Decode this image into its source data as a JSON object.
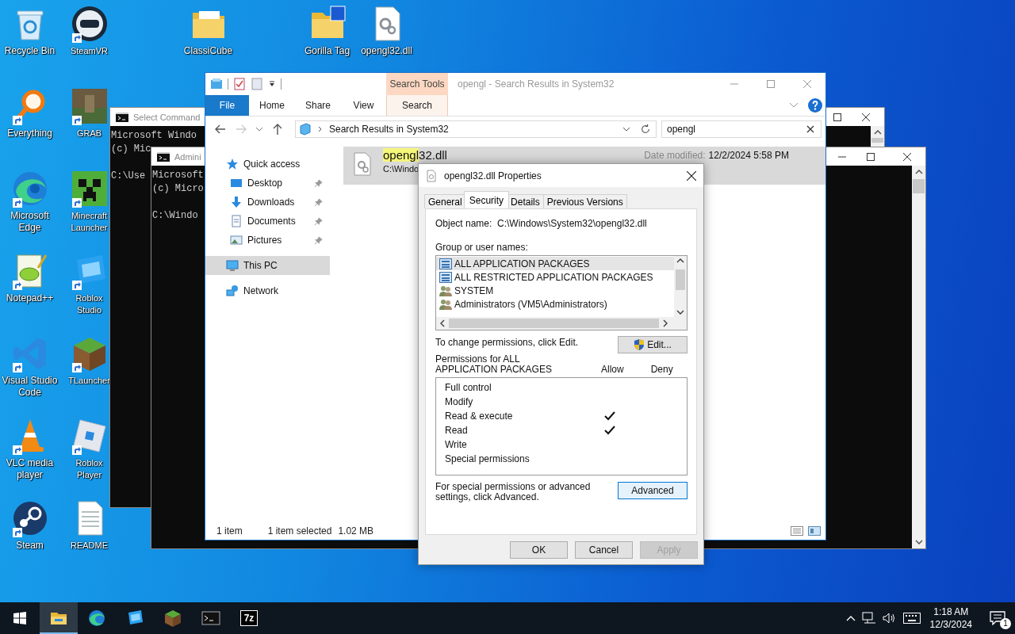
{
  "desktop": {
    "icons": [
      {
        "label": "Recycle Bin",
        "kind": "recycle",
        "shortcut": false
      },
      {
        "label": "Everything",
        "kind": "everything",
        "shortcut": true
      },
      {
        "label": "Microsoft Edge",
        "kind": "edge",
        "shortcut": true
      },
      {
        "label": "Notepad++",
        "kind": "notepad",
        "shortcut": true
      },
      {
        "label": "Visual Studio Code",
        "kind": "vscode",
        "shortcut": true
      },
      {
        "label": "VLC media player",
        "kind": "vlc",
        "shortcut": true
      },
      {
        "label": "Steam",
        "kind": "steam",
        "shortcut": true
      },
      {
        "label": "SteamVR",
        "kind": "vr",
        "shortcut": true
      },
      {
        "label": "GRAB",
        "kind": "photo",
        "shortcut": true
      },
      {
        "label": "Minecraft Launcher",
        "kind": "creeper",
        "shortcut": true
      },
      {
        "label": "Roblox Studio",
        "kind": "studio",
        "shortcut": true
      },
      {
        "label": "TLauncher",
        "kind": "grass",
        "shortcut": true
      },
      {
        "label": "Roblox Player",
        "kind": "roblox",
        "shortcut": true
      },
      {
        "label": "README",
        "kind": "text",
        "shortcut": false
      },
      {
        "label": "ClassiCube",
        "kind": "folder",
        "shortcut": false
      },
      {
        "label": "Gorilla Tag",
        "kind": "zipfolder",
        "shortcut": false
      },
      {
        "label": "opengl32.dll",
        "kind": "dll",
        "shortcut": false
      }
    ]
  },
  "console_windows": [
    {
      "title": "Select Command",
      "header": [
        "Microsoft Windo",
        "(c) Mic"
      ],
      "prompt": "C:\\Use"
    },
    {
      "title": "Admini",
      "header": [
        "Microsoft",
        "(c) Micro"
      ],
      "prompt": "C:\\Windo"
    }
  ],
  "explorer": {
    "title": "opengl - Search Results in System32",
    "context_group": "Search Tools",
    "ribbon_tabs": [
      {
        "label": "File",
        "kind": "file",
        "selected": false
      },
      {
        "label": "Home",
        "kind": "tab",
        "selected": false
      },
      {
        "label": "Share",
        "kind": "tab",
        "selected": false
      },
      {
        "label": "View",
        "kind": "tab",
        "selected": false
      },
      {
        "label": "Search",
        "kind": "context",
        "selected": true
      }
    ],
    "address": "Search Results in System32",
    "search": {
      "value": "opengl"
    },
    "nav": [
      {
        "label": "Quick access",
        "kind": "star",
        "selected": false,
        "children": [
          {
            "label": "Desktop",
            "kind": "desktop",
            "pinned": true,
            "selected": false
          },
          {
            "label": "Downloads",
            "kind": "downloads",
            "pinned": true,
            "selected": false
          },
          {
            "label": "Documents",
            "kind": "documents",
            "pinned": true,
            "selected": false
          },
          {
            "label": "Pictures",
            "kind": "pictures",
            "pinned": true,
            "selected": false
          }
        ]
      },
      {
        "label": "This PC",
        "kind": "pc",
        "selected": true
      },
      {
        "label": "Network",
        "kind": "network",
        "selected": false
      }
    ],
    "results": [
      {
        "match": "opengl",
        "rest": "32.dll",
        "location": "C:\\Windo",
        "date_label": "Date modified:",
        "date": "12/2/2024 5:58 PM",
        "selected": true
      }
    ],
    "status": {
      "count": "1 item",
      "selection": "1 item selected",
      "size": "1.02 MB"
    }
  },
  "properties_dialog": {
    "title": "opengl32.dll Properties",
    "tabs": [
      {
        "label": "General",
        "selected": false
      },
      {
        "label": "Security",
        "selected": true
      },
      {
        "label": "Details",
        "selected": false
      },
      {
        "label": "Previous Versions",
        "selected": false
      }
    ],
    "object_name_label": "Object name:",
    "object_name": "C:\\Windows\\System32\\opengl32.dll",
    "groups_label": "Group or user names:",
    "groups": [
      {
        "name": "ALL APPLICATION PACKAGES",
        "kind": "package",
        "selected": true
      },
      {
        "name": "ALL RESTRICTED APPLICATION PACKAGES",
        "kind": "package",
        "selected": false
      },
      {
        "name": "SYSTEM",
        "kind": "users",
        "selected": false
      },
      {
        "name": "Administrators (VM5\\Administrators)",
        "kind": "users",
        "selected": false
      }
    ],
    "edit_hint": "To change permissions, click Edit.",
    "edit_button": "Edit...",
    "permissions_label": "Permissions for ALL APPLICATION PACKAGES",
    "allow_header": "Allow",
    "deny_header": "Deny",
    "permissions": [
      {
        "name": "Full control",
        "allow": false,
        "deny": false
      },
      {
        "name": "Modify",
        "allow": false,
        "deny": false
      },
      {
        "name": "Read & execute",
        "allow": true,
        "deny": false
      },
      {
        "name": "Read",
        "allow": true,
        "deny": false
      },
      {
        "name": "Write",
        "allow": false,
        "deny": false
      },
      {
        "name": "Special permissions",
        "allow": false,
        "deny": false
      }
    ],
    "advanced_hint": "For special permissions or advanced settings, click Advanced.",
    "advanced_button": "Advanced",
    "buttons": [
      {
        "label": "OK",
        "disabled": false
      },
      {
        "label": "Cancel",
        "disabled": false
      },
      {
        "label": "Apply",
        "disabled": true
      }
    ]
  },
  "taskbar": {
    "apps": [
      {
        "kind": "explorer",
        "active": true
      },
      {
        "kind": "edge",
        "active": false
      },
      {
        "kind": "studio",
        "active": false
      },
      {
        "kind": "grass",
        "active": false
      },
      {
        "kind": "console",
        "active": false
      },
      {
        "kind": "sevenzip",
        "active": false,
        "label": "7z"
      }
    ],
    "time": "1:18 AM",
    "date": "12/3/2024",
    "notifications": "1"
  }
}
